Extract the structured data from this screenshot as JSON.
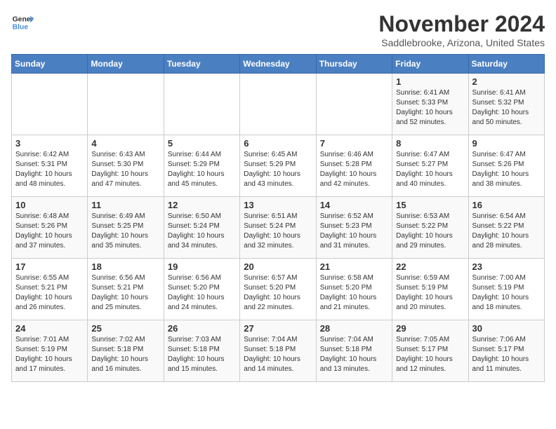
{
  "logo": {
    "general": "General",
    "blue": "Blue"
  },
  "title": "November 2024",
  "subtitle": "Saddlebrooke, Arizona, United States",
  "weekdays": [
    "Sunday",
    "Monday",
    "Tuesday",
    "Wednesday",
    "Thursday",
    "Friday",
    "Saturday"
  ],
  "weeks": [
    [
      {
        "day": "",
        "info": ""
      },
      {
        "day": "",
        "info": ""
      },
      {
        "day": "",
        "info": ""
      },
      {
        "day": "",
        "info": ""
      },
      {
        "day": "",
        "info": ""
      },
      {
        "day": "1",
        "info": "Sunrise: 6:41 AM\nSunset: 5:33 PM\nDaylight: 10 hours and 52 minutes."
      },
      {
        "day": "2",
        "info": "Sunrise: 6:41 AM\nSunset: 5:32 PM\nDaylight: 10 hours and 50 minutes."
      }
    ],
    [
      {
        "day": "3",
        "info": "Sunrise: 6:42 AM\nSunset: 5:31 PM\nDaylight: 10 hours and 48 minutes."
      },
      {
        "day": "4",
        "info": "Sunrise: 6:43 AM\nSunset: 5:30 PM\nDaylight: 10 hours and 47 minutes."
      },
      {
        "day": "5",
        "info": "Sunrise: 6:44 AM\nSunset: 5:29 PM\nDaylight: 10 hours and 45 minutes."
      },
      {
        "day": "6",
        "info": "Sunrise: 6:45 AM\nSunset: 5:29 PM\nDaylight: 10 hours and 43 minutes."
      },
      {
        "day": "7",
        "info": "Sunrise: 6:46 AM\nSunset: 5:28 PM\nDaylight: 10 hours and 42 minutes."
      },
      {
        "day": "8",
        "info": "Sunrise: 6:47 AM\nSunset: 5:27 PM\nDaylight: 10 hours and 40 minutes."
      },
      {
        "day": "9",
        "info": "Sunrise: 6:47 AM\nSunset: 5:26 PM\nDaylight: 10 hours and 38 minutes."
      }
    ],
    [
      {
        "day": "10",
        "info": "Sunrise: 6:48 AM\nSunset: 5:26 PM\nDaylight: 10 hours and 37 minutes."
      },
      {
        "day": "11",
        "info": "Sunrise: 6:49 AM\nSunset: 5:25 PM\nDaylight: 10 hours and 35 minutes."
      },
      {
        "day": "12",
        "info": "Sunrise: 6:50 AM\nSunset: 5:24 PM\nDaylight: 10 hours and 34 minutes."
      },
      {
        "day": "13",
        "info": "Sunrise: 6:51 AM\nSunset: 5:24 PM\nDaylight: 10 hours and 32 minutes."
      },
      {
        "day": "14",
        "info": "Sunrise: 6:52 AM\nSunset: 5:23 PM\nDaylight: 10 hours and 31 minutes."
      },
      {
        "day": "15",
        "info": "Sunrise: 6:53 AM\nSunset: 5:22 PM\nDaylight: 10 hours and 29 minutes."
      },
      {
        "day": "16",
        "info": "Sunrise: 6:54 AM\nSunset: 5:22 PM\nDaylight: 10 hours and 28 minutes."
      }
    ],
    [
      {
        "day": "17",
        "info": "Sunrise: 6:55 AM\nSunset: 5:21 PM\nDaylight: 10 hours and 26 minutes."
      },
      {
        "day": "18",
        "info": "Sunrise: 6:56 AM\nSunset: 5:21 PM\nDaylight: 10 hours and 25 minutes."
      },
      {
        "day": "19",
        "info": "Sunrise: 6:56 AM\nSunset: 5:20 PM\nDaylight: 10 hours and 24 minutes."
      },
      {
        "day": "20",
        "info": "Sunrise: 6:57 AM\nSunset: 5:20 PM\nDaylight: 10 hours and 22 minutes."
      },
      {
        "day": "21",
        "info": "Sunrise: 6:58 AM\nSunset: 5:20 PM\nDaylight: 10 hours and 21 minutes."
      },
      {
        "day": "22",
        "info": "Sunrise: 6:59 AM\nSunset: 5:19 PM\nDaylight: 10 hours and 20 minutes."
      },
      {
        "day": "23",
        "info": "Sunrise: 7:00 AM\nSunset: 5:19 PM\nDaylight: 10 hours and 18 minutes."
      }
    ],
    [
      {
        "day": "24",
        "info": "Sunrise: 7:01 AM\nSunset: 5:19 PM\nDaylight: 10 hours and 17 minutes."
      },
      {
        "day": "25",
        "info": "Sunrise: 7:02 AM\nSunset: 5:18 PM\nDaylight: 10 hours and 16 minutes."
      },
      {
        "day": "26",
        "info": "Sunrise: 7:03 AM\nSunset: 5:18 PM\nDaylight: 10 hours and 15 minutes."
      },
      {
        "day": "27",
        "info": "Sunrise: 7:04 AM\nSunset: 5:18 PM\nDaylight: 10 hours and 14 minutes."
      },
      {
        "day": "28",
        "info": "Sunrise: 7:04 AM\nSunset: 5:18 PM\nDaylight: 10 hours and 13 minutes."
      },
      {
        "day": "29",
        "info": "Sunrise: 7:05 AM\nSunset: 5:17 PM\nDaylight: 10 hours and 12 minutes."
      },
      {
        "day": "30",
        "info": "Sunrise: 7:06 AM\nSunset: 5:17 PM\nDaylight: 10 hours and 11 minutes."
      }
    ]
  ]
}
